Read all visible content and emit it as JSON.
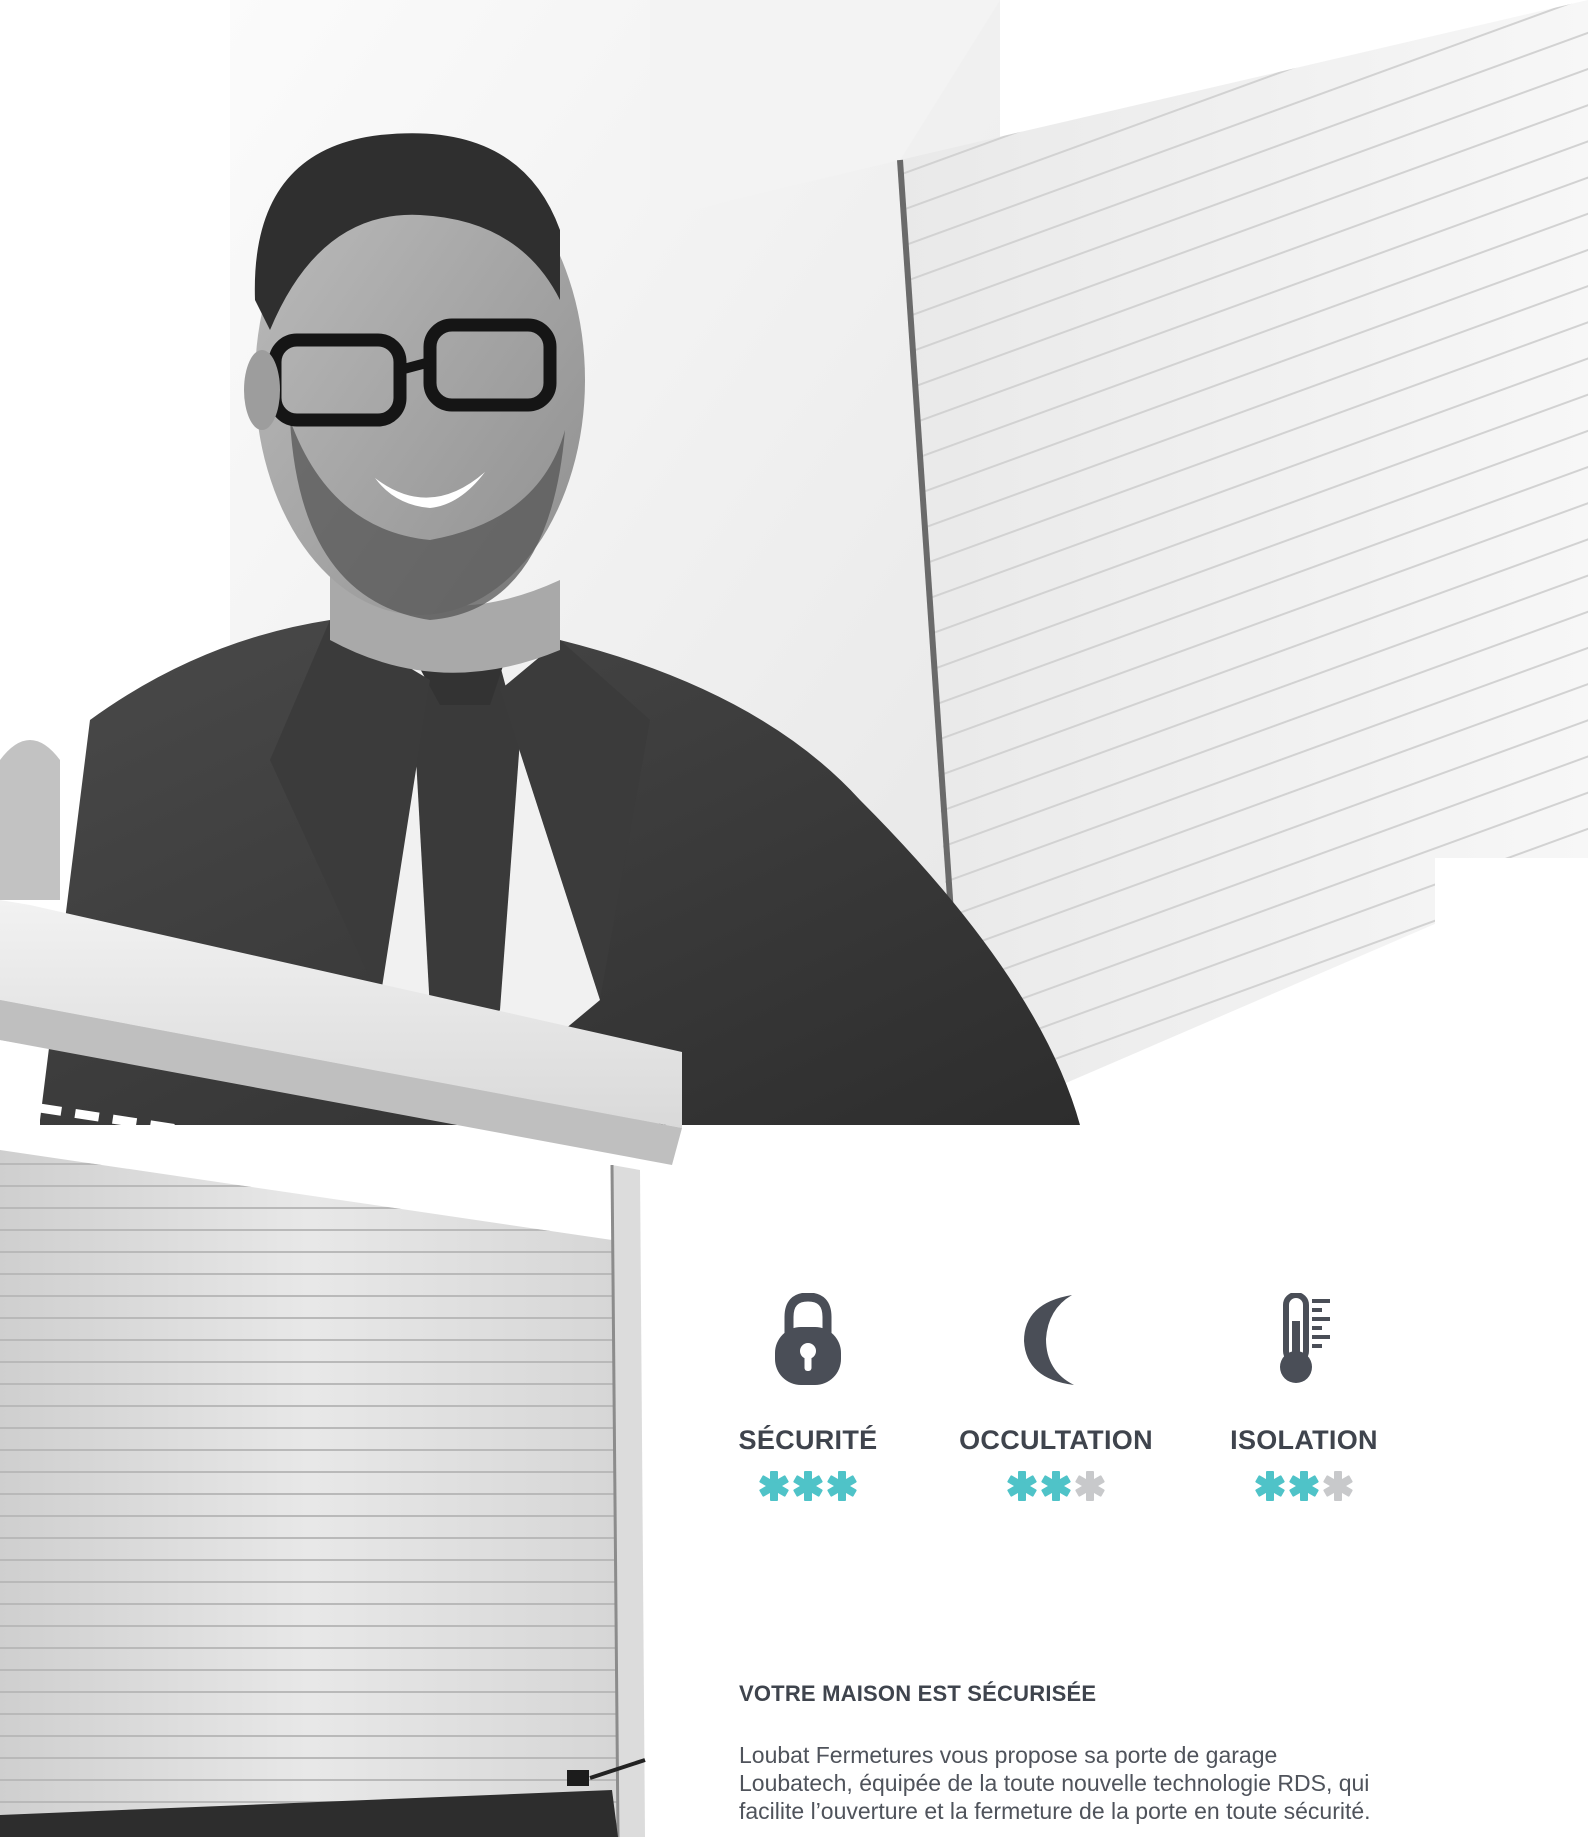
{
  "features": [
    {
      "icon": "padlock-icon",
      "label": "SÉCURITÉ",
      "rating": 3,
      "max_rating": 5
    },
    {
      "icon": "moon-icon",
      "label": "OCCULTATION",
      "rating": 2,
      "max_rating": 3
    },
    {
      "icon": "thermometer-icon",
      "label": "ISOLATION",
      "rating": 2,
      "max_rating": 3
    }
  ],
  "section": {
    "heading": "VOTRE MAISON EST SÉCURISÉE",
    "paragraph": "Loubat Fermetures vous propose sa porte de garage Loubatech, équipée de la toute nouvelle technologie RDS, qui facilite l’ouverture et la fermeture de la porte en toute sécurité."
  },
  "colors": {
    "accent": "#4fc3c8",
    "star_inactive": "#c8c9cb",
    "icon": "#4a4e57"
  }
}
